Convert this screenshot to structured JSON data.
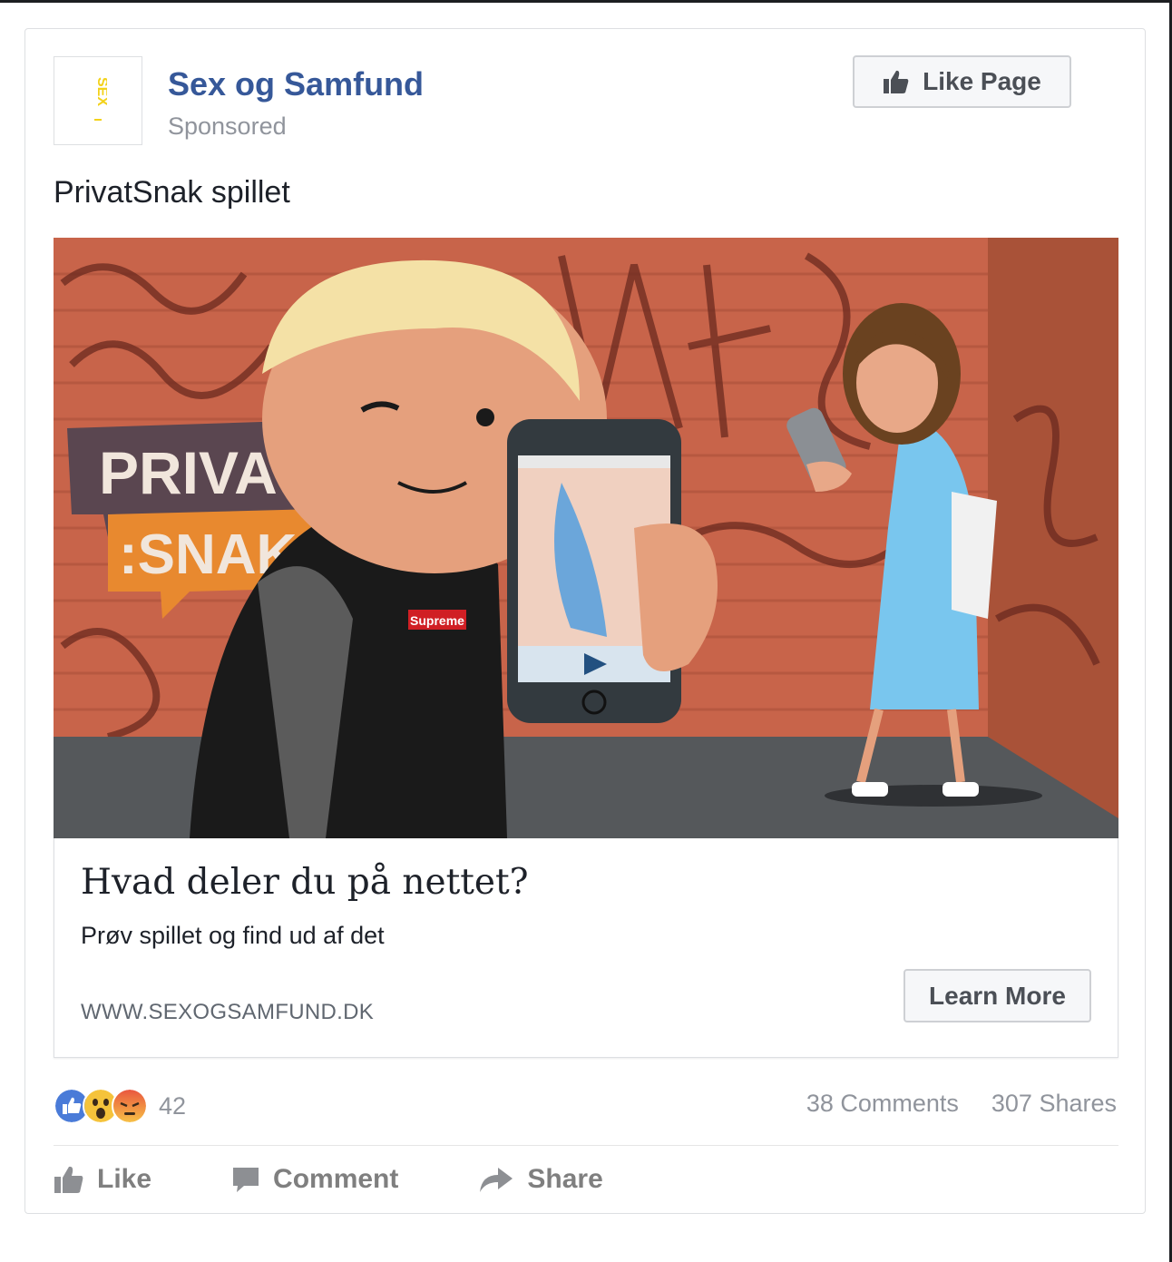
{
  "post": {
    "page_name": "Sex og Samfund",
    "sponsored": "Sponsored",
    "like_page_label": "Like Page",
    "text": "PrivatSnak spillet",
    "logo_text": "SEX"
  },
  "image": {
    "graffiti_line1": "PRIVAT",
    "graffiti_line2": ":SNAK",
    "shirt_logo": "Supreme"
  },
  "link": {
    "headline": "Hvad deler du på nettet?",
    "description": "Prøv spillet og find ud af det",
    "url": "WWW.SEXOGSAMFUND.DK",
    "cta": "Learn More"
  },
  "engagement": {
    "reaction_icons": [
      "like-reaction-icon",
      "wow-reaction-icon",
      "angry-reaction-icon"
    ],
    "reaction_count": "42",
    "comments": "38 Comments",
    "shares": "307 Shares"
  },
  "actions": {
    "like": "Like",
    "comment": "Comment",
    "share": "Share"
  },
  "colors": {
    "link_blue": "#365899",
    "brick": "#c8644a",
    "like_blue": "#4a7bd8",
    "reaction_yellow": "#f5c33b",
    "angry_red": "#e9573f"
  }
}
